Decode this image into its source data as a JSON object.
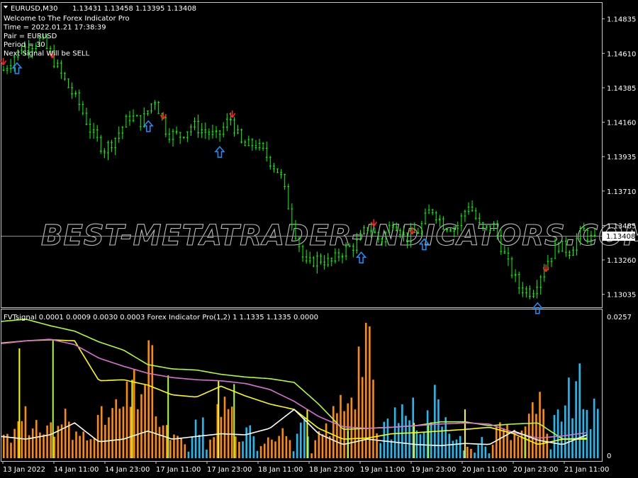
{
  "chart_info": {
    "symbol_tf": "EURUSD,M30",
    "ohlc": "1.13431 1.13458 1.13395 1.13408"
  },
  "info_lines": [
    "Welcome to The Forex Indicator Pro",
    "Time = 2022.01.21 17:38:39",
    "Pair = EURUSD",
    "Period = 30",
    "Next Signal Will be SELL"
  ],
  "watermark": "BEST-METATRADER-INDICATORS.COM",
  "indicator_label": "FVTsignal 0.0001 0.0009 0.0030 0.0003  Forex Indicator Pro(1,2)  1 1.1335 1.1335 0.0000",
  "colors": {
    "candle": "#00ff00",
    "up_arrow": "#1e90ff",
    "down_arrow": "#ff2020",
    "hist_orange": "#ff8c00",
    "hist_blue": "#1ebcf0",
    "line_green": "#adff2f",
    "line_yellow": "#ffff00",
    "line_magenta": "#da70d6",
    "line_white": "#ffffff"
  },
  "chart_data": [
    {
      "type": "candlestick",
      "title": "EURUSD,M30",
      "y_ticks": [
        "1.14835",
        "1.14610",
        "1.14385",
        "1.14160",
        "1.13935",
        "1.13710",
        "1.13485",
        "1.13260",
        "1.13035"
      ],
      "ylim": [
        1.1295,
        1.1494
      ],
      "current_price": "1.13408",
      "x_ticks": [
        "13 Jan 2022",
        "14 Jan 11:00",
        "14 Jan 23:00",
        "17 Jan 11:00",
        "17 Jan 23:00",
        "18 Jan 11:00",
        "18 Jan 23:00",
        "19 Jan 11:00",
        "19 Jan 23:00",
        "20 Jan 11:00",
        "20 Jan 23:00",
        "21 Jan 11:00"
      ],
      "price_path": [
        1.145,
        1.1461,
        1.1466,
        1.147,
        1.1456,
        1.1441,
        1.1428,
        1.1409,
        1.1398,
        1.1407,
        1.142,
        1.1416,
        1.1432,
        1.1409,
        1.1407,
        1.1414,
        1.141,
        1.1406,
        1.1419,
        1.14,
        1.1402,
        1.1393,
        1.1382,
        1.135,
        1.1322,
        1.1327,
        1.1324,
        1.1332,
        1.1336,
        1.1348,
        1.1338,
        1.1352,
        1.134,
        1.1345,
        1.136,
        1.1349,
        1.1347,
        1.1363,
        1.1345,
        1.1348,
        1.1325,
        1.1308,
        1.1305,
        1.1322,
        1.1336,
        1.1332,
        1.1345,
        1.1338
      ],
      "signals": [
        {
          "x_frac": 0.003,
          "dir": "sell"
        },
        {
          "x_frac": 0.026,
          "dir": "buy"
        },
        {
          "x_frac": 0.085,
          "dir": "sell"
        },
        {
          "x_frac": 0.245,
          "dir": "buy"
        },
        {
          "x_frac": 0.27,
          "dir": "sell"
        },
        {
          "x_frac": 0.364,
          "dir": "buy"
        },
        {
          "x_frac": 0.385,
          "dir": "sell"
        },
        {
          "x_frac": 0.6,
          "dir": "buy"
        },
        {
          "x_frac": 0.621,
          "dir": "sell"
        },
        {
          "x_frac": 0.685,
          "dir": "sell"
        },
        {
          "x_frac": 0.705,
          "dir": "buy"
        },
        {
          "x_frac": 0.894,
          "dir": "buy"
        },
        {
          "x_frac": 0.908,
          "dir": "sell"
        }
      ]
    },
    {
      "type": "bar",
      "title": "FVTsignal",
      "y_ticks": [
        "0.0257",
        "0"
      ],
      "ylim": [
        0,
        0.0257
      ],
      "histogram": [
        0.004,
        0.003,
        0.012,
        0.003,
        0.005,
        0.006,
        0.004,
        0.008,
        0.003,
        0.004,
        0.005,
        0.006,
        0.007,
        0.008,
        0.009,
        0.011,
        0.013,
        0.017,
        0.006,
        0.004,
        0.003,
        0.002,
        -0.004,
        -0.007,
        0.004,
        0.008,
        0.01,
        0.005,
        -0.004,
        -0.005,
        0.003,
        0.004,
        0.005,
        0.004,
        -0.004,
        -0.005,
        0.002,
        0.004,
        0.006,
        0.009,
        0.012,
        0.016,
        0.024,
        0.01,
        -0.006,
        -0.005,
        -0.008,
        -0.009,
        -0.007,
        -0.006,
        -0.01,
        -0.009,
        -0.005,
        -0.003,
        0.002,
        -0.002,
        -0.003,
        0.004,
        0.006,
        0.004,
        0.005,
        0.006,
        0.01,
        0.005,
        -0.006,
        -0.01,
        -0.01,
        -0.012,
        -0.008,
        -0.007
      ],
      "series": [
        {
          "color_key": "line_green",
          "values": [
            0.0248,
            0.0252,
            0.024,
            0.023,
            0.021,
            0.0195,
            0.0168,
            0.016,
            0.0158,
            0.015,
            0.0145,
            0.0142,
            0.0135,
            0.0095,
            0.0048,
            0.005,
            0.0052,
            0.0055,
            0.0062,
            0.0062,
            0.0055,
            0.0058,
            0.006,
            0.003,
            0.0032
          ]
        },
        {
          "color_key": "line_yellow",
          "values": [
            0.0208,
            0.0212,
            0.0214,
            0.0212,
            0.0138,
            0.014,
            0.013,
            0.0112,
            0.0108,
            0.0128,
            0.011,
            0.0095,
            0.0085,
            0.005,
            0.003,
            0.0032,
            0.004,
            0.0042,
            0.0045,
            0.0048,
            0.0052,
            0.004,
            0.002,
            0.003,
            0.003
          ]
        },
        {
          "color_key": "line_magenta",
          "values": [
            0.0207,
            0.0212,
            0.0215,
            0.0205,
            0.018,
            0.0165,
            0.0152,
            0.0144,
            0.014,
            0.0138,
            0.0133,
            0.0122,
            0.01,
            0.0072,
            0.0053,
            0.005,
            0.0052,
            0.0055,
            0.0058,
            0.006,
            0.0058,
            0.0042,
            0.0032,
            0.0036,
            0.0042
          ]
        },
        {
          "color_key": "line_white",
          "values": [
            0.0035,
            0.003,
            0.0038,
            0.006,
            0.0025,
            0.003,
            0.0045,
            0.003,
            0.0035,
            0.004,
            0.0038,
            0.005,
            0.0085,
            0.004,
            0.002,
            0.003,
            0.0025,
            0.002,
            0.0018,
            0.0022,
            0.002,
            0.0045,
            0.0028,
            0.002,
            0.0038
          ]
        }
      ],
      "step_lines": [
        {
          "x_frac": 0.03,
          "top": 0.0198
        },
        {
          "x_frac": 0.086,
          "top": 0.0215
        },
        {
          "x_frac": 0.218,
          "top": 0.014
        },
        {
          "x_frac": 0.278,
          "top": 0.0148
        },
        {
          "x_frac": 0.362,
          "top": 0.0138
        },
        {
          "x_frac": 0.388,
          "top": 0.0132
        },
        {
          "x_frac": 0.51,
          "top": 0.0085
        },
        {
          "x_frac": 0.578,
          "top": 0.0045
        },
        {
          "x_frac": 0.688,
          "top": 0.006
        },
        {
          "x_frac": 0.712,
          "top": 0.0058
        },
        {
          "x_frac": 0.773,
          "top": 0.0085
        },
        {
          "x_frac": 0.873,
          "top": 0.004
        }
      ]
    }
  ]
}
